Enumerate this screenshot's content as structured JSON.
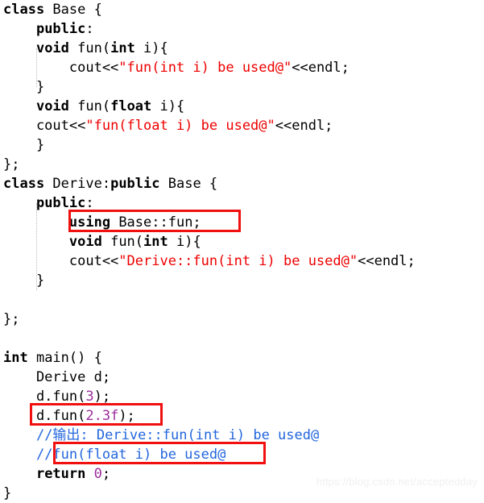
{
  "editor": {
    "language": "C++",
    "background_color": "#ffffff",
    "colors": {
      "keyword": "#000000",
      "plain": "#000000",
      "string": "#ee0000",
      "number": "#9b2d9b",
      "comment": "#2266dd",
      "annotation_box": "#f01010",
      "indent_guide": "#b8b8b8",
      "watermark": "#f0f0f0"
    },
    "lines": [
      {
        "indent": 0,
        "text": "class Base {"
      },
      {
        "indent": 1,
        "text": "public:"
      },
      {
        "indent": 1,
        "text": "void fun(int i){"
      },
      {
        "indent": 2,
        "text": "cout<<\"fun(int i) be used@\"<<endl;"
      },
      {
        "indent": 1,
        "text": "}"
      },
      {
        "indent": 1,
        "text": "void fun(float i){"
      },
      {
        "indent": 1,
        "text": "cout<<\"fun(float i) be used@\"<<endl;"
      },
      {
        "indent": 1,
        "text": "}"
      },
      {
        "indent": 0,
        "text": "};"
      },
      {
        "indent": 0,
        "text": "class Derive:public Base {"
      },
      {
        "indent": 1,
        "text": "public:"
      },
      {
        "indent": 2,
        "text": "using Base::fun;"
      },
      {
        "indent": 2,
        "text": "void fun(int i){"
      },
      {
        "indent": 2,
        "text": "cout<<\"Derive::fun(int i) be used@\"<<endl;"
      },
      {
        "indent": 1,
        "text": "}"
      },
      {
        "indent": 0,
        "text": ""
      },
      {
        "indent": 0,
        "text": "};"
      },
      {
        "indent": 0,
        "text": ""
      },
      {
        "indent": 0,
        "text": "int main() {"
      },
      {
        "indent": 1,
        "text": "Derive d;"
      },
      {
        "indent": 1,
        "text": "d.fun(3);"
      },
      {
        "indent": 1,
        "text": "d.fun(2.3f);"
      },
      {
        "indent": 1,
        "text": "//输出: Derive::fun(int i) be used@"
      },
      {
        "indent": 1,
        "text": "//fun(float i) be used@"
      },
      {
        "indent": 1,
        "text": "return 0;"
      },
      {
        "indent": 0,
        "text": "}"
      }
    ],
    "annotations": [
      {
        "label": "using-base-fun-highlight",
        "target_text": "using Base::fun;"
      },
      {
        "label": "d-fun-float-call-highlight",
        "target_text": "d.fun(2.3f);"
      },
      {
        "label": "float-output-comment-highlight",
        "target_text": "fun(float i) be used@"
      }
    ],
    "watermark": "https://blog.csdn.net/acceptedday"
  }
}
